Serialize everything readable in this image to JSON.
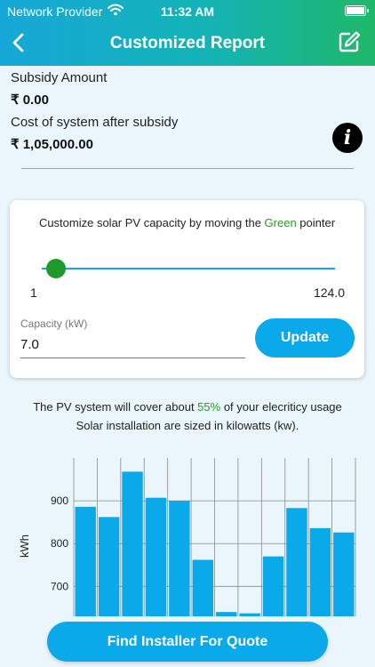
{
  "status_bar": {
    "provider": "Network Provider",
    "time": "11:32 AM"
  },
  "header": {
    "title": "Customized Report"
  },
  "subsidy": {
    "amount_label": "Subsidy Amount",
    "amount_value": "₹ 0.00",
    "cost_label": "Cost of system after subsidy",
    "cost_value": "₹ 1,05,000.00"
  },
  "card": {
    "title_prefix": "Customize solar PV capacity by moving the ",
    "title_highlight": "Green",
    "title_suffix": " pointer",
    "slider": {
      "min": 1,
      "max": 124,
      "value": 7,
      "min_label": "1",
      "max_label": "124.0"
    },
    "capacity_label": "Capacity (kW)",
    "capacity_value": "7.0",
    "update_label": "Update"
  },
  "coverage": {
    "prefix": "The PV system will cover about ",
    "percent": "55%",
    "suffix": " of your elecriticy usage",
    "line2": "Solar installation are sized in kilowatts (kw)."
  },
  "chart_data": {
    "type": "bar",
    "ylabel": "kWh",
    "yticks": [
      700,
      800,
      900
    ],
    "ylim": [
      630,
      1000
    ],
    "values": [
      886,
      862,
      968,
      907,
      900,
      762,
      640,
      637,
      770,
      883,
      836,
      826
    ],
    "grid": true,
    "bar_color": "#09a9ea"
  },
  "actions": {
    "find_installer_label": "Find Installer For Quote"
  },
  "colors": {
    "accent": "#09a9ea",
    "highlight": "#2a9a2a",
    "header_start": "#16a8d8",
    "header_end": "#1fb86a"
  }
}
